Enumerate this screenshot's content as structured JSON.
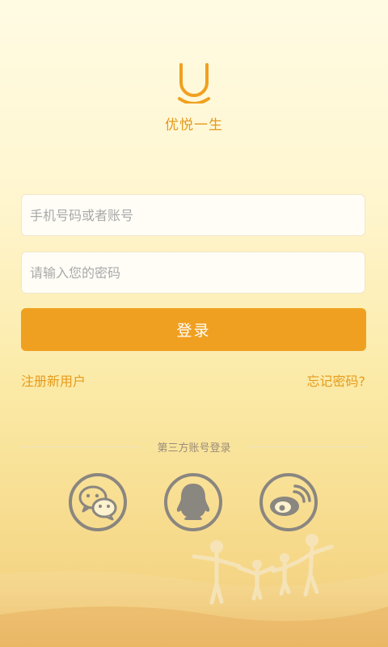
{
  "brand": {
    "name": "优悦一生"
  },
  "login": {
    "username_placeholder": "手机号码或者账号",
    "password_placeholder": "请输入您的密码",
    "submit_label": "登录"
  },
  "links": {
    "register": "注册新用户",
    "forgot": "忘记密码?"
  },
  "third_party": {
    "label": "第三方账号登录",
    "items": [
      {
        "icon": "wechat-icon"
      },
      {
        "icon": "qq-icon"
      },
      {
        "icon": "weibo-icon"
      }
    ]
  },
  "colors": {
    "accent": "#f0a020",
    "brand_text": "#e39a1c",
    "icon_gray": "#8a8680"
  }
}
